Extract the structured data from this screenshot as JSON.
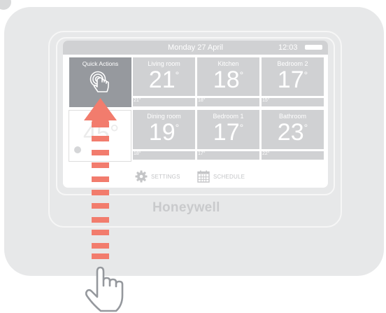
{
  "status_bar": {
    "date": "Monday 27 April",
    "time": "12:03"
  },
  "quick_actions": {
    "label": "Quick Actions",
    "icon": "touch-icon"
  },
  "zones": [
    {
      "name": "Living room",
      "temp": "21",
      "setpoint": "21°"
    },
    {
      "name": "Kitchen",
      "temp": "18",
      "setpoint": "18°"
    },
    {
      "name": "Bedroom 2",
      "temp": "17",
      "setpoint": "15°"
    },
    {
      "name": "Dining room",
      "temp": "19",
      "setpoint": "18°"
    },
    {
      "name": "Bedroom 1",
      "temp": "17",
      "setpoint": "17°"
    },
    {
      "name": "Bathroom",
      "temp": "23",
      "setpoint": "22°"
    }
  ],
  "hidden_tile": {
    "temp": "45°"
  },
  "degree_symbol": "°",
  "bottom_bar": {
    "settings_label": "SETTINGS",
    "schedule_label": "SCHEDULE"
  },
  "brand": "Honeywell",
  "colors": {
    "shell": "#e7e8e9",
    "tile": "#d0d1d3",
    "quick_actions_tile": "#96999e",
    "arrow": "#f27c6d"
  },
  "annotation": {
    "gesture": "swipe-up",
    "icons": [
      "arrow-up-icon",
      "hand-pointer-icon"
    ]
  }
}
